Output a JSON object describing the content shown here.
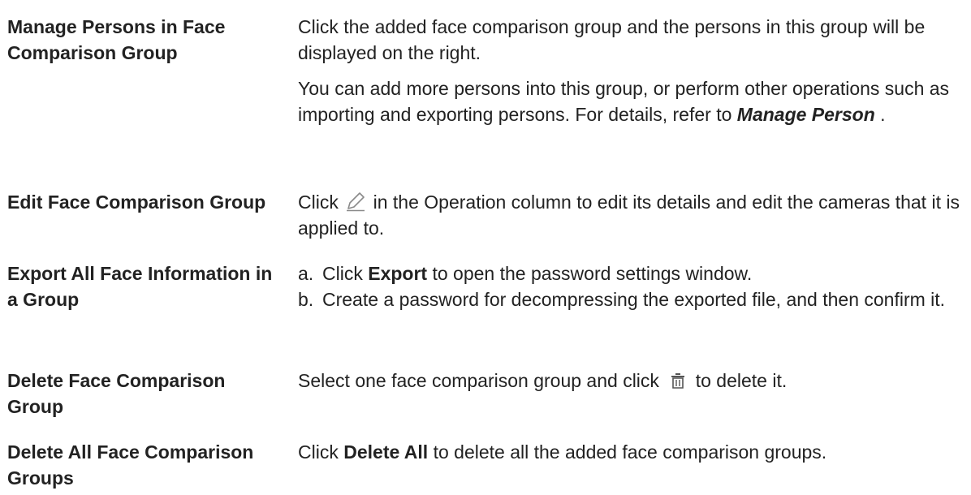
{
  "rows": [
    {
      "term": "Manage Persons in Face Comparison Group",
      "para1": "Click the added face comparison group and the persons in this group will be displayed on the right.",
      "para2_text": "You can add more persons into this group, or perform other operations such as importing and exporting persons. For details, refer to ",
      "para2_link": "Manage Person",
      "para2_end": " ."
    },
    {
      "term": "Edit Face Comparison Group",
      "before_icon": "Click ",
      "icon": "pencil-icon",
      "after_icon": " in the Operation column to edit its details and edit the cameras that it is applied to."
    },
    {
      "term": "Export All Face Information in a Group",
      "steps": [
        {
          "marker": "a.",
          "before": "Click ",
          "bold": "Export",
          "after": " to open the password settings window."
        },
        {
          "marker": "b.",
          "text": "Create a password for decompressing the exported file, and then confirm it."
        }
      ]
    },
    {
      "term": "Delete Face Comparison Group",
      "before_icon": "Select one face comparison group and click ",
      "icon": "trash-icon",
      "after_icon": " to delete it."
    },
    {
      "term": "Delete All Face Comparison Groups",
      "before": "Click ",
      "bold": "Delete All",
      "after": " to delete all the added face comparison groups."
    }
  ]
}
